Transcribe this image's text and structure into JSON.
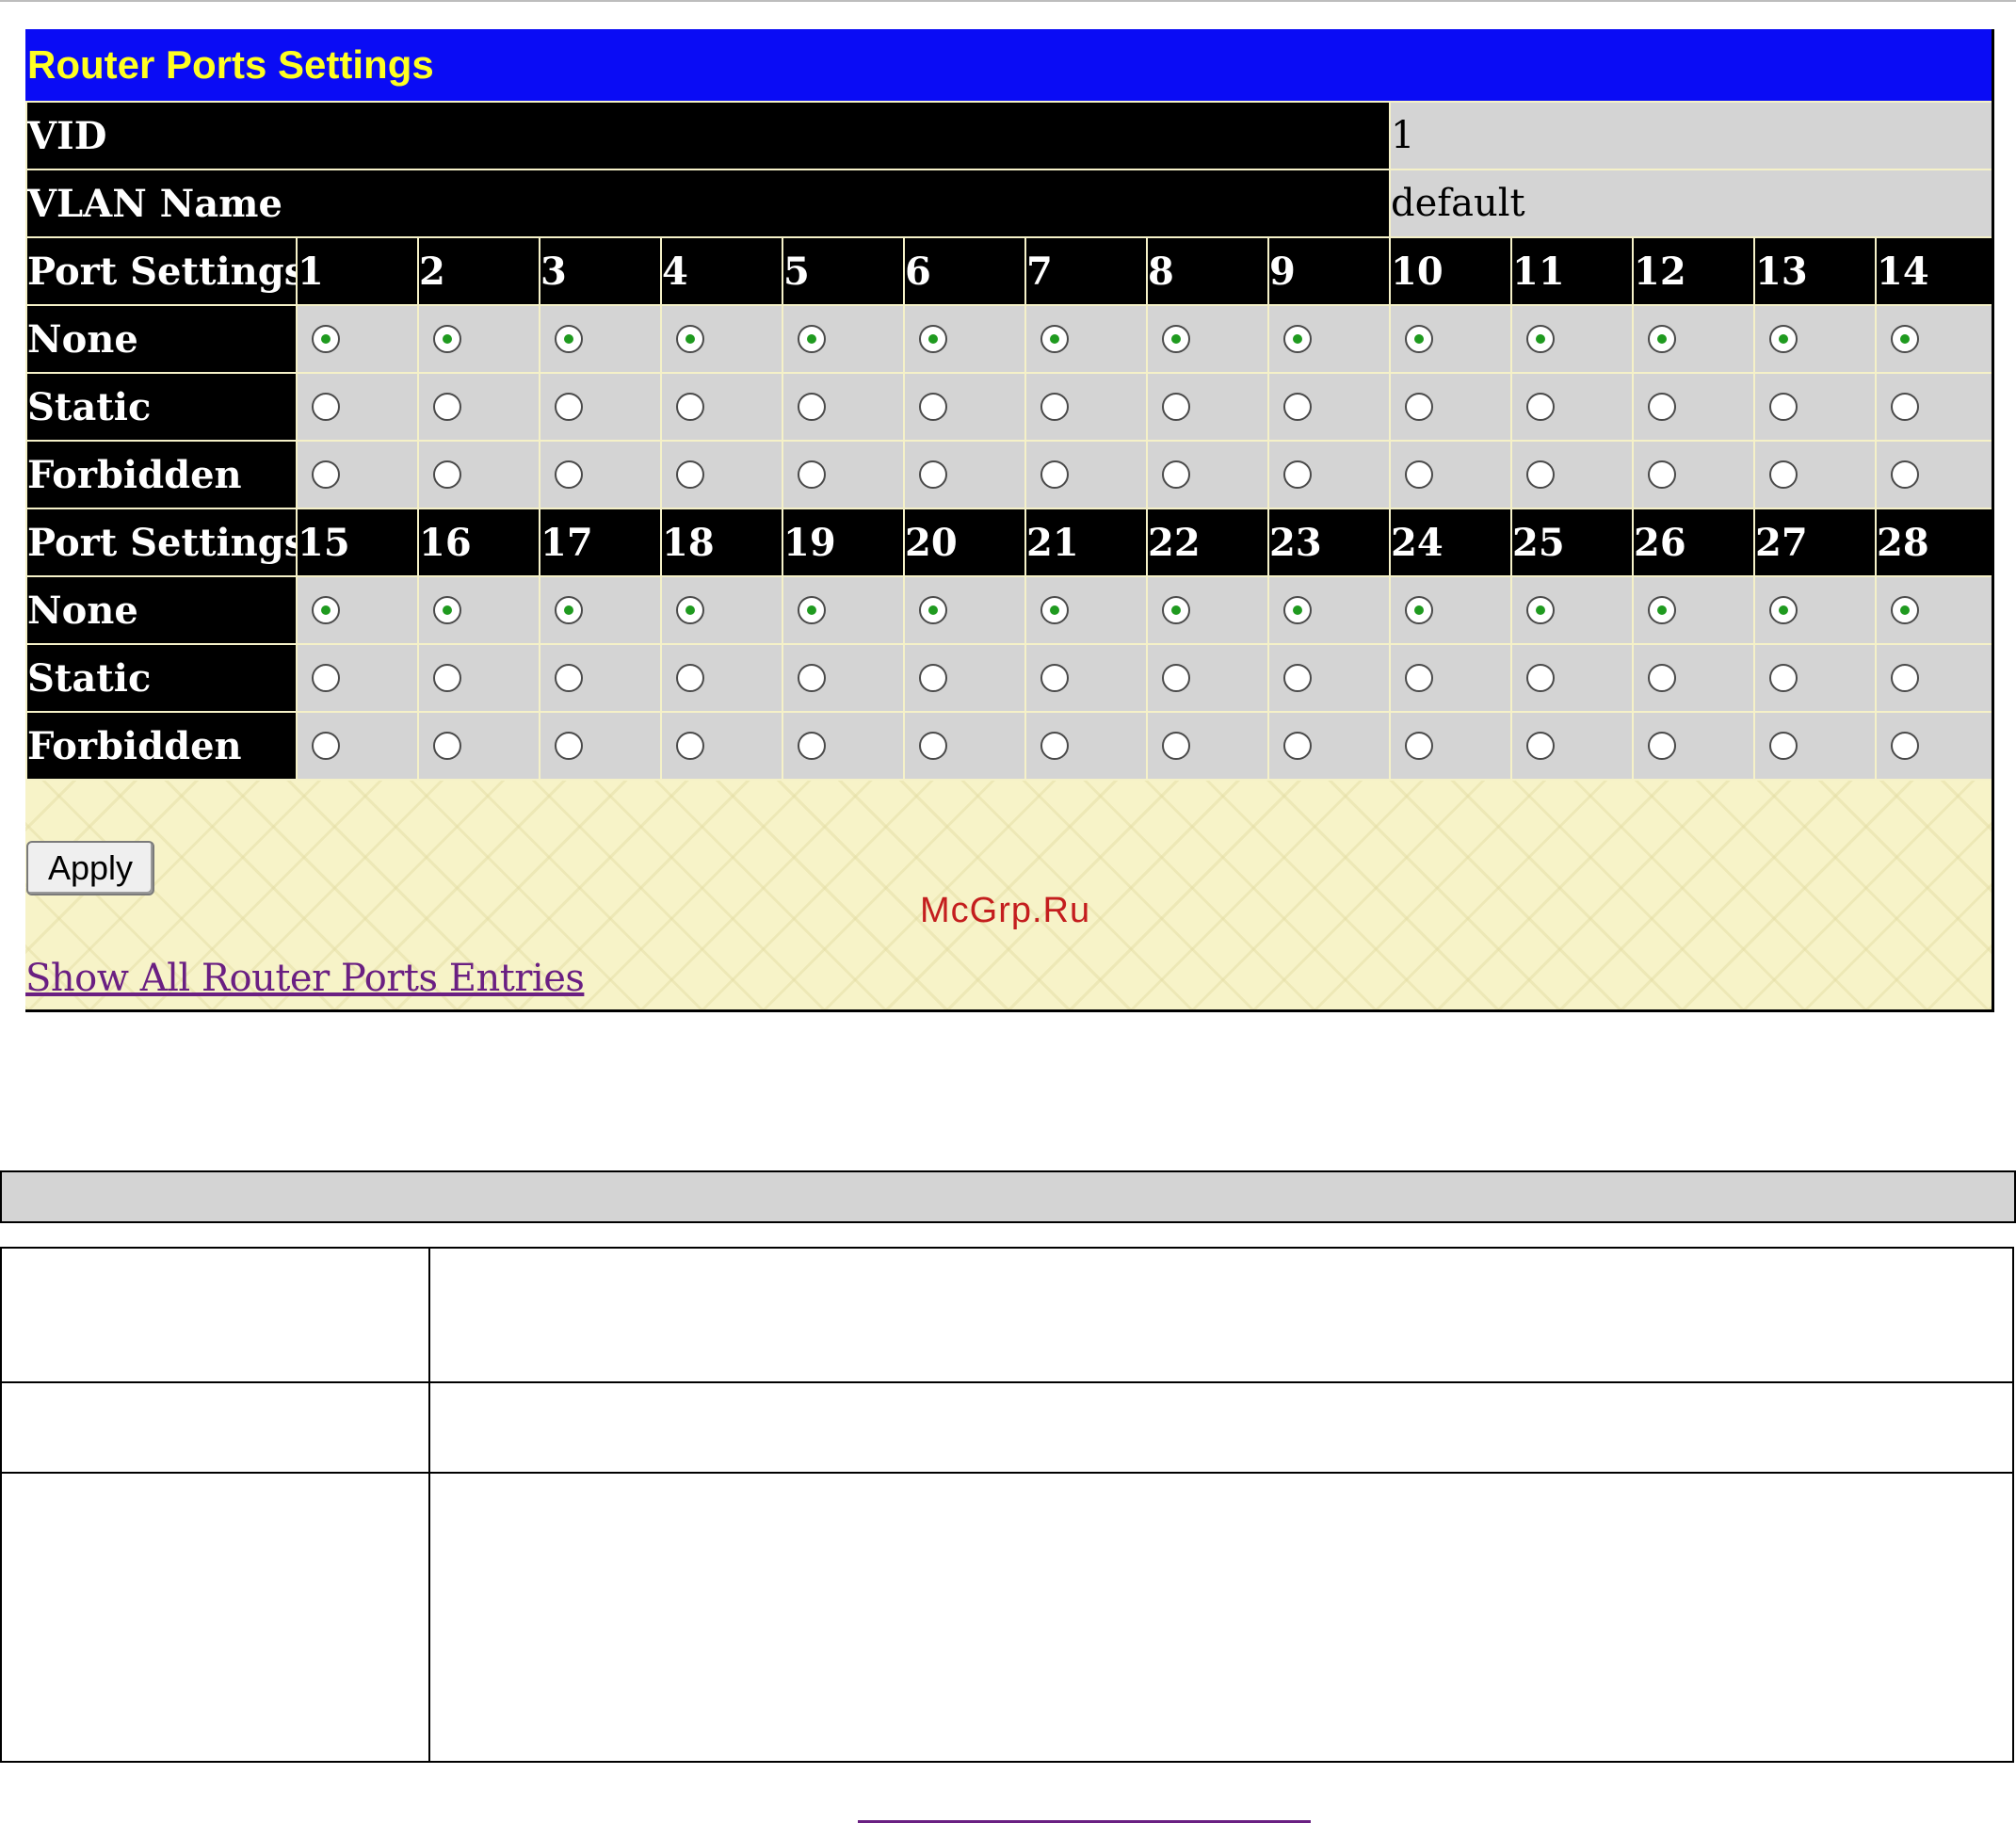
{
  "panel": {
    "title": "Router Ports Settings",
    "vid": {
      "label": "VID",
      "value": "1"
    },
    "vlan_name": {
      "label": "VLAN Name",
      "value": "default"
    },
    "groups": [
      {
        "header_label": "Port Settings",
        "ports": [
          "1",
          "2",
          "3",
          "4",
          "5",
          "6",
          "7",
          "8",
          "9",
          "10",
          "11",
          "12",
          "13",
          "14"
        ],
        "rows": [
          {
            "label": "None",
            "selected": true
          },
          {
            "label": "Static",
            "selected": false
          },
          {
            "label": "Forbidden",
            "selected": false
          }
        ]
      },
      {
        "header_label": "Port Settings",
        "ports": [
          "15",
          "16",
          "17",
          "18",
          "19",
          "20",
          "21",
          "22",
          "23",
          "24",
          "25",
          "26",
          "27",
          "28"
        ],
        "rows": [
          {
            "label": "None",
            "selected": true
          },
          {
            "label": "Static",
            "selected": false
          },
          {
            "label": "Forbidden",
            "selected": false
          }
        ]
      }
    ],
    "apply_label": "Apply",
    "show_all_link": "Show All Router Ports Entries"
  },
  "watermark": "McGrp.Ru",
  "colors": {
    "title_bar": "#0a0cf5",
    "title_text": "#ffff22",
    "label_cell": "#000000",
    "value_cell": "#d4d4d4",
    "panel_background": "#f7f3c8",
    "link": "#6a1f82",
    "radio_selected_dot": "#1f9a1f"
  }
}
